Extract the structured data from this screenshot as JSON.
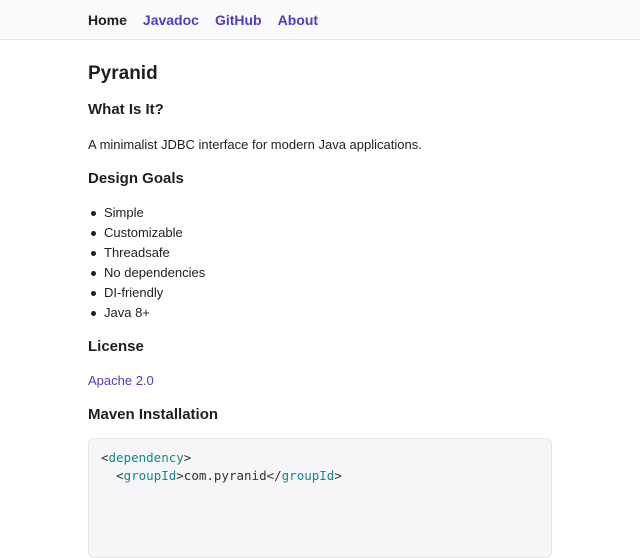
{
  "nav": {
    "items": [
      {
        "label": "Home",
        "active": true
      },
      {
        "label": "Javadoc",
        "active": false
      },
      {
        "label": "GitHub",
        "active": false
      },
      {
        "label": "About",
        "active": false
      }
    ]
  },
  "page": {
    "title": "Pyranid",
    "what_heading": "What Is It?",
    "what_text": "A minimalist JDBC interface for modern Java applications.",
    "goals_heading": "Design Goals",
    "goals": [
      "Simple",
      "Customizable",
      "Threadsafe",
      "No dependencies",
      "DI-friendly",
      "Java 8+"
    ],
    "license_heading": "License",
    "license_link": "Apache 2.0",
    "maven_heading": "Maven Installation",
    "code": {
      "line1_open": "<",
      "line1_tag": "dependency",
      "line1_close": ">",
      "line2_indent": "  ",
      "line2_open": "<",
      "line2_tag": "groupId",
      "line2_mid": ">com.pyranid</",
      "line2_tag2": "groupId",
      "line2_close": ">"
    }
  },
  "colors": {
    "accent": "#4a3fc1",
    "code_tag": "#0f8a8a"
  }
}
